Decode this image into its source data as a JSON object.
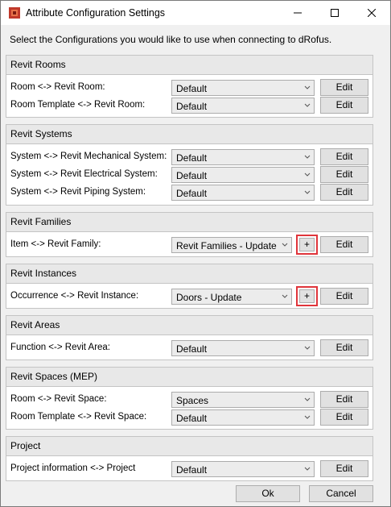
{
  "window": {
    "title": "Attribute Configuration Settings",
    "intro": "Select the Configurations you would like to use when connecting to dRofus."
  },
  "groups": [
    {
      "header": "Revit Rooms",
      "rows": [
        {
          "label": "Room <-> Revit Room:",
          "value": "Default",
          "edit": "Edit"
        },
        {
          "label": "Room Template <-> Revit Room:",
          "value": "Default",
          "edit": "Edit"
        }
      ]
    },
    {
      "header": "Revit Systems",
      "rows": [
        {
          "label": "System <-> Revit Mechanical System:",
          "value": "Default",
          "edit": "Edit"
        },
        {
          "label": "System <-> Revit Electrical System:",
          "value": "Default",
          "edit": "Edit"
        },
        {
          "label": "System <-> Revit Piping System:",
          "value": "Default",
          "edit": "Edit"
        }
      ]
    },
    {
      "header": "Revit Families",
      "rows": [
        {
          "label": "Item <-> Revit Family:",
          "value": "Revit Families - Update",
          "plus": "+",
          "edit": "Edit"
        }
      ]
    },
    {
      "header": "Revit Instances",
      "rows": [
        {
          "label": "Occurrence <-> Revit Instance:",
          "value": "Doors - Update",
          "plus": "+",
          "edit": "Edit"
        }
      ]
    },
    {
      "header": "Revit Areas",
      "rows": [
        {
          "label": "Function <-> Revit Area:",
          "value": "Default",
          "edit": "Edit"
        }
      ]
    },
    {
      "header": "Revit Spaces (MEP)",
      "rows": [
        {
          "label": "Room <-> Revit Space:",
          "value": "Spaces",
          "edit": "Edit"
        },
        {
          "label": "Room Template <-> Revit Space:",
          "value": "Default",
          "edit": "Edit"
        }
      ]
    },
    {
      "header": "Project",
      "rows": [
        {
          "label": "Project information <-> Project",
          "value": "Default",
          "edit": "Edit"
        }
      ]
    }
  ],
  "footer": {
    "ok": "Ok",
    "cancel": "Cancel"
  },
  "colors": {
    "highlight": "#e0353b",
    "app_icon": "#c0392b"
  },
  "icons": {
    "app": "drofus-app-icon",
    "minimize": "minimize-icon",
    "maximize": "maximize-icon",
    "close": "close-icon",
    "dropdown": "chevron-down-icon"
  }
}
